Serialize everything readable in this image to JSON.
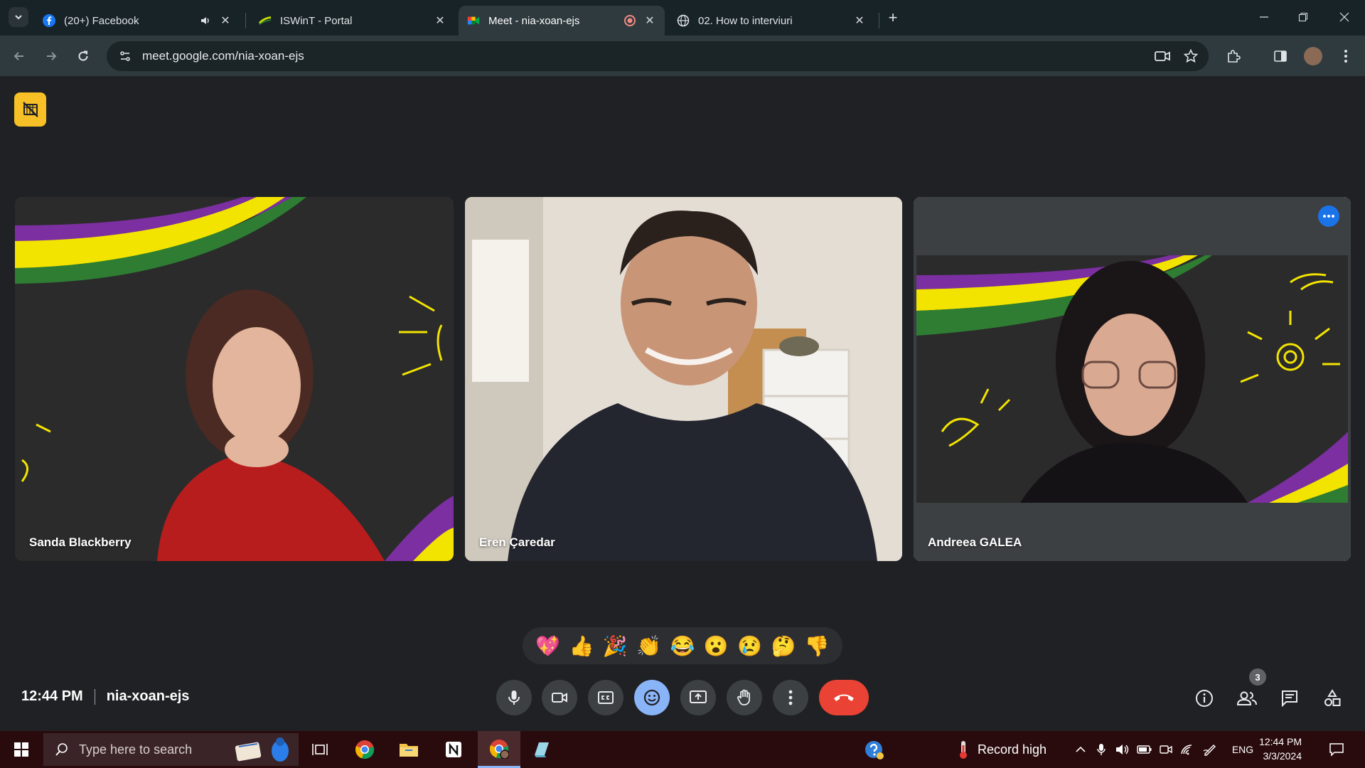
{
  "browser": {
    "tabs": [
      {
        "title": "(20+) Facebook",
        "favicon": "facebook-icon",
        "extra": "speaker-icon"
      },
      {
        "title": "ISWinT - Portal",
        "favicon": "iswint-icon"
      },
      {
        "title": "Meet - nia-xoan-ejs",
        "favicon": "google-meet-icon",
        "extra": "recording-icon",
        "active": true
      },
      {
        "title": "02. How to interviuri",
        "favicon": "globe-icon"
      }
    ],
    "url": "meet.google.com/nia-xoan-ejs"
  },
  "participants": [
    {
      "name": "Sanda Blackberry"
    },
    {
      "name": "Eren Çaredar"
    },
    {
      "name": "Andreea GALEA",
      "active_speaker": true
    }
  ],
  "reactions": [
    "💖",
    "👍",
    "🎉",
    "👏",
    "😂",
    "😮",
    "😢",
    "🤔",
    "👎"
  ],
  "meeting": {
    "time": "12:44 PM",
    "code": "nia-xoan-ejs",
    "participant_count": "3"
  },
  "taskbar": {
    "search_placeholder": "Type here to search",
    "weather": "Record high",
    "language": "ENG",
    "clock_time": "12:44 PM",
    "clock_date": "3/3/2024"
  },
  "colors": {
    "accent_blue": "#8ab4f8",
    "end_call_red": "#ea4335",
    "cam_off_yellow": "#f6c026",
    "banner_purple": "#7b2fa0",
    "banner_yellow": "#f3e400",
    "banner_green": "#2e7d32"
  }
}
